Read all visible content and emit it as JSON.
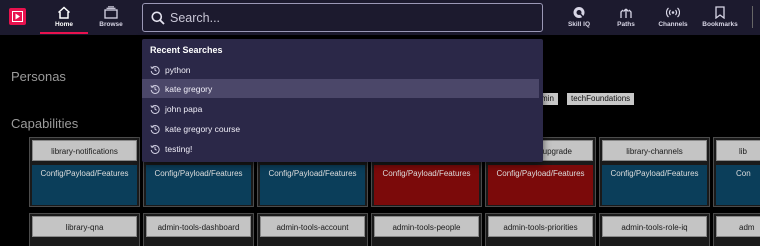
{
  "nav": {
    "home_label": "Home",
    "browse_label": "Browse",
    "skilliq_label": "Skill IQ",
    "paths_label": "Paths",
    "channels_label": "Channels",
    "bookmarks_label": "Bookmarks",
    "accent_color": "#e8124e"
  },
  "search": {
    "placeholder": "Search..."
  },
  "dropdown": {
    "heading": "Recent Searches",
    "items": [
      {
        "label": "python",
        "highlighted": false
      },
      {
        "label": "kate gregory",
        "highlighted": true
      },
      {
        "label": "john papa",
        "highlighted": false
      },
      {
        "label": "kate gregory course",
        "highlighted": false
      },
      {
        "label": "testing!",
        "highlighted": false
      }
    ]
  },
  "main": {
    "personas_heading": "Personas",
    "capabilities_heading": "Capabilities",
    "tags": [
      "min",
      "techFoundations"
    ],
    "row1": [
      {
        "title": "library-notifications",
        "feature": "Config/Payload/Features",
        "color": "blue"
      },
      {
        "title": "",
        "feature": "Config/Payload/Features",
        "color": "blue"
      },
      {
        "title": "",
        "feature": "Config/Payload/Features",
        "color": "blue"
      },
      {
        "title": "",
        "feature": "Config/Payload/Features",
        "color": "red"
      },
      {
        "title": "upgrade",
        "feature": "Config/Payload/Features",
        "color": "red"
      },
      {
        "title": "library-channels",
        "feature": "Config/Payload/Features",
        "color": "blue"
      },
      {
        "title": "lib",
        "feature": "Con",
        "color": "blue"
      }
    ],
    "row2": [
      {
        "title": "library-qna"
      },
      {
        "title": "admin-tools-dashboard"
      },
      {
        "title": "admin-tools-account"
      },
      {
        "title": "admin-tools-people"
      },
      {
        "title": "admin-tools-priorities"
      },
      {
        "title": "admin-tools-role-iq"
      },
      {
        "title": "adm"
      }
    ]
  }
}
